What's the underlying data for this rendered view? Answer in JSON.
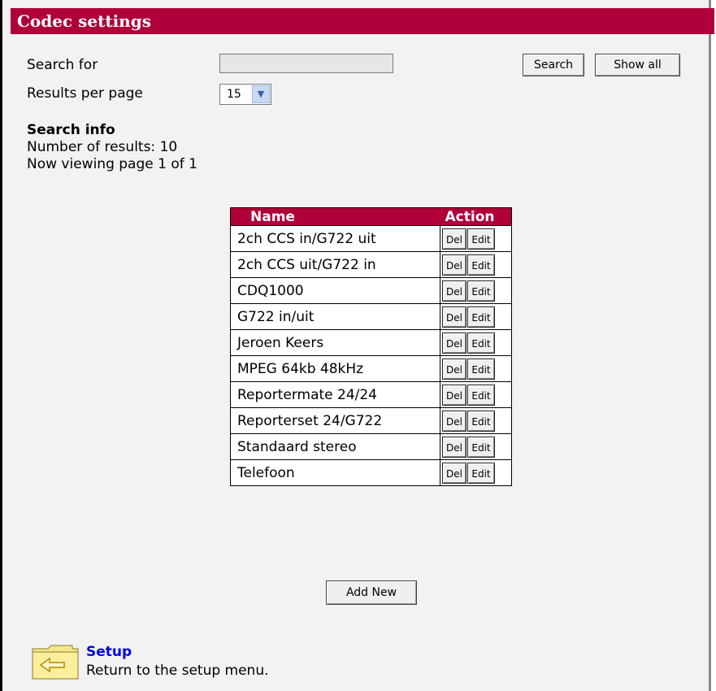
{
  "page": {
    "title": "Codec settings"
  },
  "search": {
    "label": "Search for",
    "value": "",
    "search_button": "Search",
    "show_all_button": "Show all"
  },
  "results_per_page": {
    "label": "Results per page",
    "value": "15"
  },
  "search_info": {
    "heading": "Search info",
    "count_line": "Number of results:  10",
    "page_line": "Now viewing page 1 of 1"
  },
  "table": {
    "headers": [
      "Name",
      "Action"
    ],
    "del_label": "Del",
    "edit_label": "Edit",
    "rows": [
      "2ch CCS in/G722 uit",
      "2ch CCS uit/G722 in",
      "CDQ1000",
      "G722 in/uit",
      "Jeroen Keers",
      "MPEG 64kb 48kHz",
      "Reportermate 24/24",
      "Reporterset 24/G722",
      "Standaard stereo",
      "Telefoon"
    ]
  },
  "add_new_button": "Add New",
  "footer": {
    "link": "Setup",
    "description": "Return to the setup menu."
  },
  "colors": {
    "accent": "#b0003a",
    "link": "#0000ee",
    "background": "#f2f2f2"
  },
  "icons": {
    "folder": "folder-back-icon",
    "dropdown": "chevron-down-icon"
  }
}
